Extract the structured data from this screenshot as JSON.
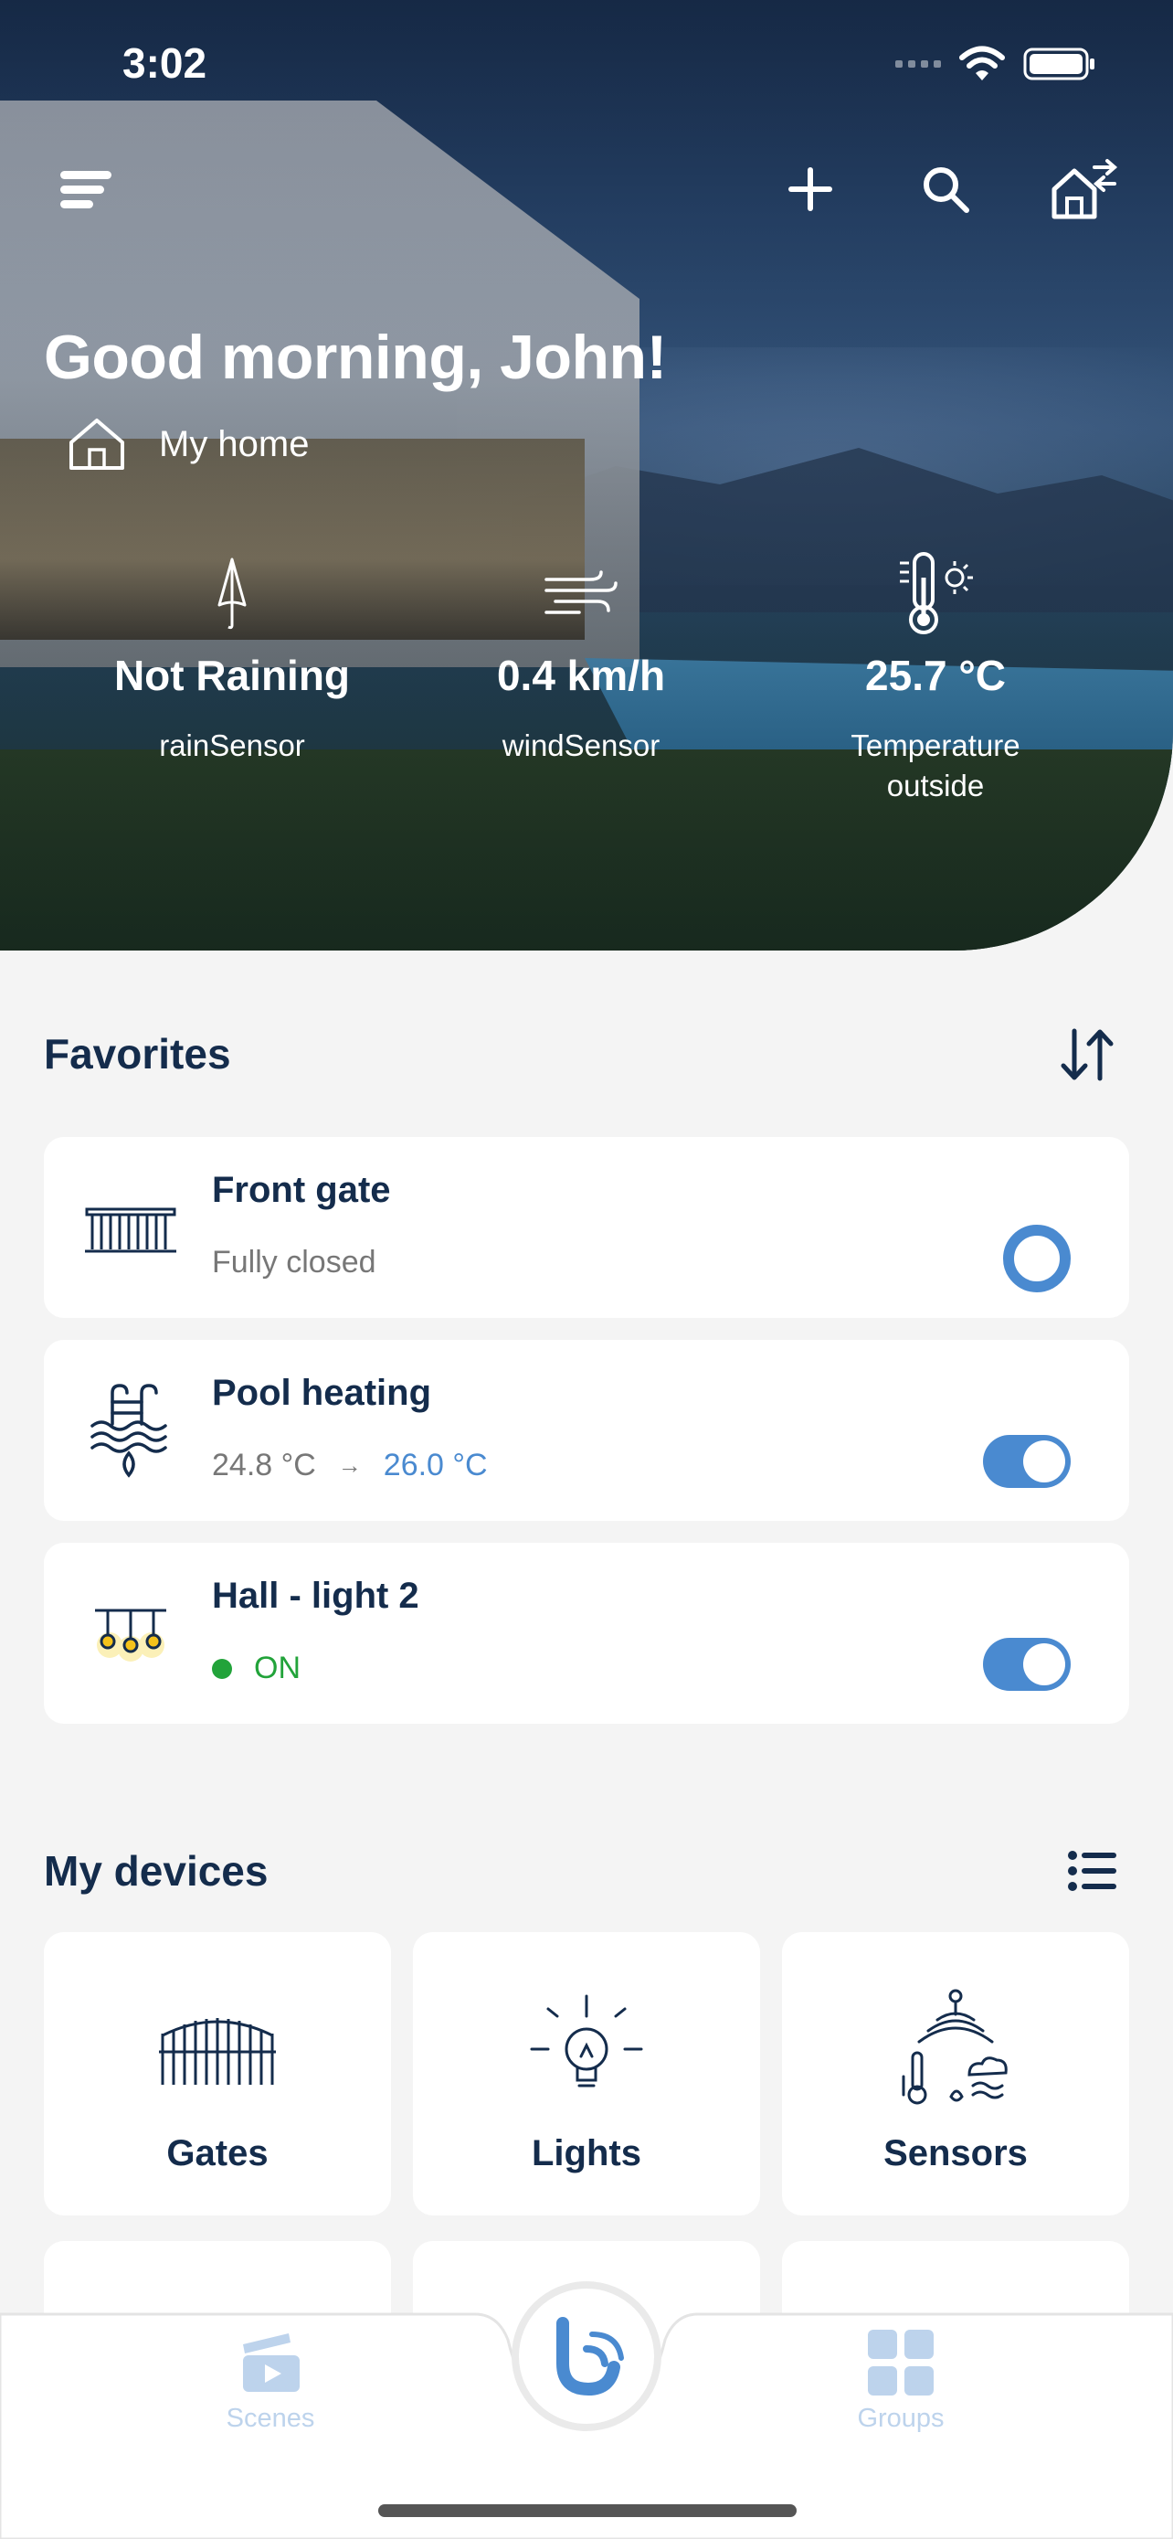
{
  "status_bar": {
    "time": "3:02"
  },
  "header": {
    "greeting": "Good morning, John!",
    "home_name": "My home"
  },
  "weather": [
    {
      "value": "Not Raining",
      "label": "rainSensor",
      "icon": "umbrella-icon"
    },
    {
      "value": "0.4 km/h",
      "label": "windSensor",
      "icon": "wind-icon"
    },
    {
      "value": "25.7 °C",
      "label": "Temperature outside",
      "icon": "thermometer-sun-icon"
    }
  ],
  "favorites": {
    "title": "Favorites",
    "items": [
      {
        "name": "Front gate",
        "status": "Fully closed",
        "icon": "gate-icon",
        "control": "ring"
      },
      {
        "name": "Pool heating",
        "current": "24.8 °C",
        "arrow": "→",
        "target": "26.0 °C",
        "icon": "pool-heating-icon",
        "control": "toggle-on"
      },
      {
        "name": "Hall - light 2",
        "state": "ON",
        "icon": "chandelier-icon",
        "control": "toggle-on"
      }
    ]
  },
  "devices": {
    "title": "My devices",
    "items": [
      {
        "label": "Gates",
        "icon": "gates-icon"
      },
      {
        "label": "Lights",
        "icon": "bulb-icon"
      },
      {
        "label": "Sensors",
        "icon": "sensors-icon"
      }
    ]
  },
  "bottom_nav": {
    "left": "Scenes",
    "right": "Groups",
    "colors": {
      "inactive": "#bdd3ec",
      "accent": "#4a8ad0"
    }
  }
}
